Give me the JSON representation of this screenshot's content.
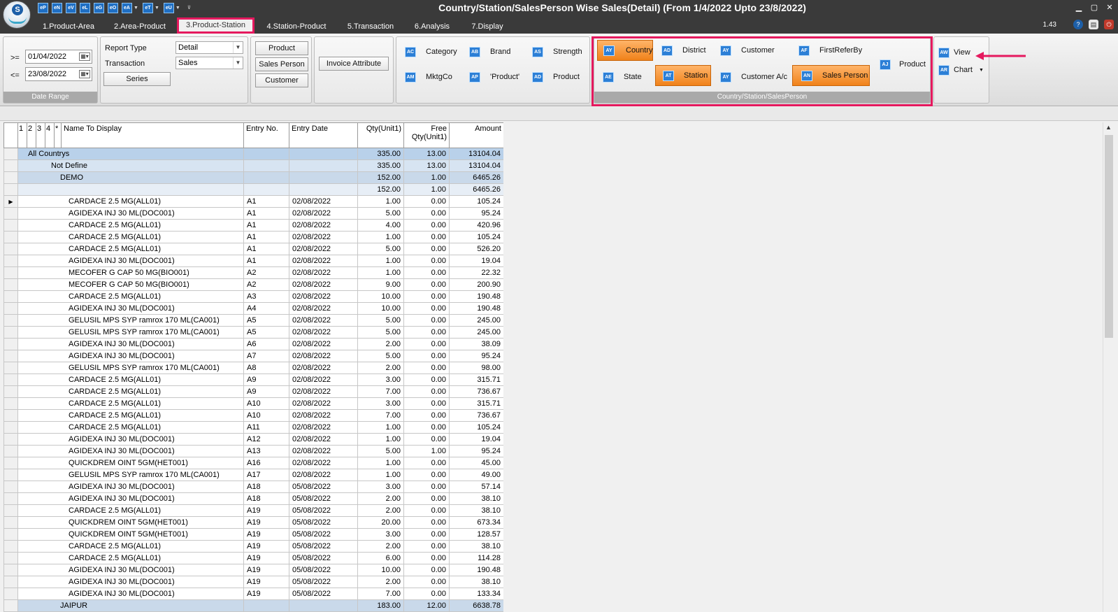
{
  "app": {
    "title": "Country/Station/SalesPerson Wise Sales(Detail) (From 1/4/2022 Upto 23/8/2022)",
    "version": "1.43",
    "quick_access": [
      "eP",
      "eN",
      "eV",
      "eL",
      "eG",
      "eO",
      "eA",
      "eT",
      "eU"
    ]
  },
  "tabs": [
    {
      "label": "1.Product-Area",
      "active": false
    },
    {
      "label": "2.Area-Product",
      "active": false
    },
    {
      "label": "3.Product-Station",
      "active": true
    },
    {
      "label": "4.Station-Product",
      "active": false
    },
    {
      "label": "5.Transaction",
      "active": false
    },
    {
      "label": "6.Analysis",
      "active": false
    },
    {
      "label": "7.Display",
      "active": false
    }
  ],
  "date_range": {
    "from_op": ">=",
    "from": "01/04/2022",
    "to_op": "<=",
    "to": "23/08/2022",
    "caption": "Date Range"
  },
  "report": {
    "type_label": "Report Type",
    "type_value": "Detail",
    "transaction_label": "Transaction",
    "transaction_value": "Sales",
    "series_label": "Series"
  },
  "filters": {
    "product": "Product",
    "sales_person": "Sales Person",
    "customer": "Customer",
    "invoice_attribute": "Invoice Attribute"
  },
  "product_group": [
    {
      "icon": "AC",
      "label": "Category"
    },
    {
      "icon": "AB",
      "label": "Brand"
    },
    {
      "icon": "AS",
      "label": "Strength"
    },
    {
      "icon": "AM",
      "label": "MktgCo"
    },
    {
      "icon": "AP",
      "label": "'Product'"
    },
    {
      "icon": "AD",
      "label": "Product"
    }
  ],
  "area_group": {
    "caption": "Country/Station/SalesPerson",
    "items": [
      {
        "icon": "AY",
        "label": "Country",
        "selected": true
      },
      {
        "icon": "AD",
        "label": "District",
        "selected": false
      },
      {
        "icon": "AY",
        "label": "Customer",
        "selected": false
      },
      {
        "icon": "AF",
        "label": "FirstReferBy",
        "selected": false
      },
      {
        "icon": "AE",
        "label": "State",
        "selected": false
      },
      {
        "icon": "AT",
        "label": "Station",
        "selected": true
      },
      {
        "icon": "AY",
        "label": "Customer A/c",
        "selected": false
      },
      {
        "icon": "AN",
        "label": "Sales Person",
        "selected": true
      },
      {
        "icon": "AJ",
        "label": "Product",
        "selected": false
      }
    ]
  },
  "view_group": {
    "view": "View",
    "view_icon": "AW",
    "chart": "Chart",
    "chart_icon": "AR"
  },
  "grid": {
    "headers": {
      "c1": "1",
      "c2": "2",
      "c3": "3",
      "c4": "4",
      "c5": "*",
      "name": "Name To Display",
      "entry_no": "Entry No.",
      "entry_date": "Entry Date",
      "qty": "Qty(Unit1)",
      "free_qty": "Free Qty(Unit1)",
      "amount": "Amount"
    },
    "rows": [
      {
        "level": 0,
        "name": "All Countrys",
        "entry": "",
        "date": "",
        "qty": "335.00",
        "free": "13.00",
        "amount": "13104.04"
      },
      {
        "level": 1,
        "name": "Not Define",
        "entry": "",
        "date": "",
        "qty": "335.00",
        "free": "13.00",
        "amount": "13104.04"
      },
      {
        "level": 2,
        "name": "DEMO",
        "entry": "",
        "date": "",
        "qty": "152.00",
        "free": "1.00",
        "amount": "6465.26"
      },
      {
        "level": 3,
        "name": "",
        "entry": "",
        "date": "",
        "qty": "152.00",
        "free": "1.00",
        "amount": "6465.26"
      },
      {
        "level": 4,
        "name": "CARDACE 2.5 MG(ALL01)",
        "entry": "A1",
        "date": "02/08/2022",
        "qty": "1.00",
        "free": "0.00",
        "amount": "105.24",
        "current": true
      },
      {
        "level": 4,
        "name": "AGIDEXA INJ 30 ML(DOC001)",
        "entry": "A1",
        "date": "02/08/2022",
        "qty": "5.00",
        "free": "0.00",
        "amount": "95.24"
      },
      {
        "level": 4,
        "name": "CARDACE 2.5 MG(ALL01)",
        "entry": "A1",
        "date": "02/08/2022",
        "qty": "4.00",
        "free": "0.00",
        "amount": "420.96"
      },
      {
        "level": 4,
        "name": "CARDACE 2.5 MG(ALL01)",
        "entry": "A1",
        "date": "02/08/2022",
        "qty": "1.00",
        "free": "0.00",
        "amount": "105.24"
      },
      {
        "level": 4,
        "name": "CARDACE 2.5 MG(ALL01)",
        "entry": "A1",
        "date": "02/08/2022",
        "qty": "5.00",
        "free": "0.00",
        "amount": "526.20"
      },
      {
        "level": 4,
        "name": "AGIDEXA INJ 30 ML(DOC001)",
        "entry": "A1",
        "date": "02/08/2022",
        "qty": "1.00",
        "free": "0.00",
        "amount": "19.04"
      },
      {
        "level": 4,
        "name": "MECOFER G CAP 50 MG(BIO001)",
        "entry": "A2",
        "date": "02/08/2022",
        "qty": "1.00",
        "free": "0.00",
        "amount": "22.32"
      },
      {
        "level": 4,
        "name": "MECOFER G CAP 50 MG(BIO001)",
        "entry": "A2",
        "date": "02/08/2022",
        "qty": "9.00",
        "free": "0.00",
        "amount": "200.90"
      },
      {
        "level": 4,
        "name": "CARDACE 2.5 MG(ALL01)",
        "entry": "A3",
        "date": "02/08/2022",
        "qty": "10.00",
        "free": "0.00",
        "amount": "190.48"
      },
      {
        "level": 4,
        "name": "AGIDEXA INJ 30 ML(DOC001)",
        "entry": "A4",
        "date": "02/08/2022",
        "qty": "10.00",
        "free": "0.00",
        "amount": "190.48"
      },
      {
        "level": 4,
        "name": "GELUSIL MPS SYP ramrox 170 ML(CA001)",
        "entry": "A5",
        "date": "02/08/2022",
        "qty": "5.00",
        "free": "0.00",
        "amount": "245.00"
      },
      {
        "level": 4,
        "name": "GELUSIL MPS SYP ramrox 170 ML(CA001)",
        "entry": "A5",
        "date": "02/08/2022",
        "qty": "5.00",
        "free": "0.00",
        "amount": "245.00"
      },
      {
        "level": 4,
        "name": "AGIDEXA INJ 30 ML(DOC001)",
        "entry": "A6",
        "date": "02/08/2022",
        "qty": "2.00",
        "free": "0.00",
        "amount": "38.09"
      },
      {
        "level": 4,
        "name": "AGIDEXA INJ 30 ML(DOC001)",
        "entry": "A7",
        "date": "02/08/2022",
        "qty": "5.00",
        "free": "0.00",
        "amount": "95.24"
      },
      {
        "level": 4,
        "name": "GELUSIL MPS SYP ramrox 170 ML(CA001)",
        "entry": "A8",
        "date": "02/08/2022",
        "qty": "2.00",
        "free": "0.00",
        "amount": "98.00"
      },
      {
        "level": 4,
        "name": "CARDACE 2.5 MG(ALL01)",
        "entry": "A9",
        "date": "02/08/2022",
        "qty": "3.00",
        "free": "0.00",
        "amount": "315.71"
      },
      {
        "level": 4,
        "name": "CARDACE 2.5 MG(ALL01)",
        "entry": "A9",
        "date": "02/08/2022",
        "qty": "7.00",
        "free": "0.00",
        "amount": "736.67"
      },
      {
        "level": 4,
        "name": "CARDACE 2.5 MG(ALL01)",
        "entry": "A10",
        "date": "02/08/2022",
        "qty": "3.00",
        "free": "0.00",
        "amount": "315.71"
      },
      {
        "level": 4,
        "name": "CARDACE 2.5 MG(ALL01)",
        "entry": "A10",
        "date": "02/08/2022",
        "qty": "7.00",
        "free": "0.00",
        "amount": "736.67"
      },
      {
        "level": 4,
        "name": "CARDACE 2.5 MG(ALL01)",
        "entry": "A11",
        "date": "02/08/2022",
        "qty": "1.00",
        "free": "0.00",
        "amount": "105.24"
      },
      {
        "level": 4,
        "name": "AGIDEXA INJ 30 ML(DOC001)",
        "entry": "A12",
        "date": "02/08/2022",
        "qty": "1.00",
        "free": "0.00",
        "amount": "19.04"
      },
      {
        "level": 4,
        "name": "AGIDEXA INJ 30 ML(DOC001)",
        "entry": "A13",
        "date": "02/08/2022",
        "qty": "5.00",
        "free": "1.00",
        "amount": "95.24"
      },
      {
        "level": 4,
        "name": "QUICKDREM OINT 5GM(HET001)",
        "entry": "A16",
        "date": "02/08/2022",
        "qty": "1.00",
        "free": "0.00",
        "amount": "45.00"
      },
      {
        "level": 4,
        "name": "GELUSIL MPS SYP ramrox 170 ML(CA001)",
        "entry": "A17",
        "date": "02/08/2022",
        "qty": "1.00",
        "free": "0.00",
        "amount": "49.00"
      },
      {
        "level": 4,
        "name": "AGIDEXA INJ 30 ML(DOC001)",
        "entry": "A18",
        "date": "05/08/2022",
        "qty": "3.00",
        "free": "0.00",
        "amount": "57.14"
      },
      {
        "level": 4,
        "name": "AGIDEXA INJ 30 ML(DOC001)",
        "entry": "A18",
        "date": "05/08/2022",
        "qty": "2.00",
        "free": "0.00",
        "amount": "38.10"
      },
      {
        "level": 4,
        "name": "CARDACE 2.5 MG(ALL01)",
        "entry": "A19",
        "date": "05/08/2022",
        "qty": "2.00",
        "free": "0.00",
        "amount": "38.10"
      },
      {
        "level": 4,
        "name": "QUICKDREM OINT 5GM(HET001)",
        "entry": "A19",
        "date": "05/08/2022",
        "qty": "20.00",
        "free": "0.00",
        "amount": "673.34"
      },
      {
        "level": 4,
        "name": "QUICKDREM OINT 5GM(HET001)",
        "entry": "A19",
        "date": "05/08/2022",
        "qty": "3.00",
        "free": "0.00",
        "amount": "128.57"
      },
      {
        "level": 4,
        "name": "CARDACE 2.5 MG(ALL01)",
        "entry": "A19",
        "date": "05/08/2022",
        "qty": "2.00",
        "free": "0.00",
        "amount": "38.10"
      },
      {
        "level": 4,
        "name": "CARDACE 2.5 MG(ALL01)",
        "entry": "A19",
        "date": "05/08/2022",
        "qty": "6.00",
        "free": "0.00",
        "amount": "114.28"
      },
      {
        "level": 4,
        "name": "AGIDEXA INJ 30 ML(DOC001)",
        "entry": "A19",
        "date": "05/08/2022",
        "qty": "10.00",
        "free": "0.00",
        "amount": "190.48"
      },
      {
        "level": 4,
        "name": "AGIDEXA INJ 30 ML(DOC001)",
        "entry": "A19",
        "date": "05/08/2022",
        "qty": "2.00",
        "free": "0.00",
        "amount": "38.10"
      },
      {
        "level": 4,
        "name": "AGIDEXA INJ 30 ML(DOC001)",
        "entry": "A19",
        "date": "05/08/2022",
        "qty": "7.00",
        "free": "0.00",
        "amount": "133.34"
      },
      {
        "level": 2,
        "name": "JAIPUR",
        "entry": "",
        "date": "",
        "qty": "183.00",
        "free": "12.00",
        "amount": "6638.78"
      }
    ]
  },
  "colors": {
    "accent_highlight": "#e5195e",
    "selected_item": "#f0821a",
    "title_bar": "#3a3a3a"
  }
}
